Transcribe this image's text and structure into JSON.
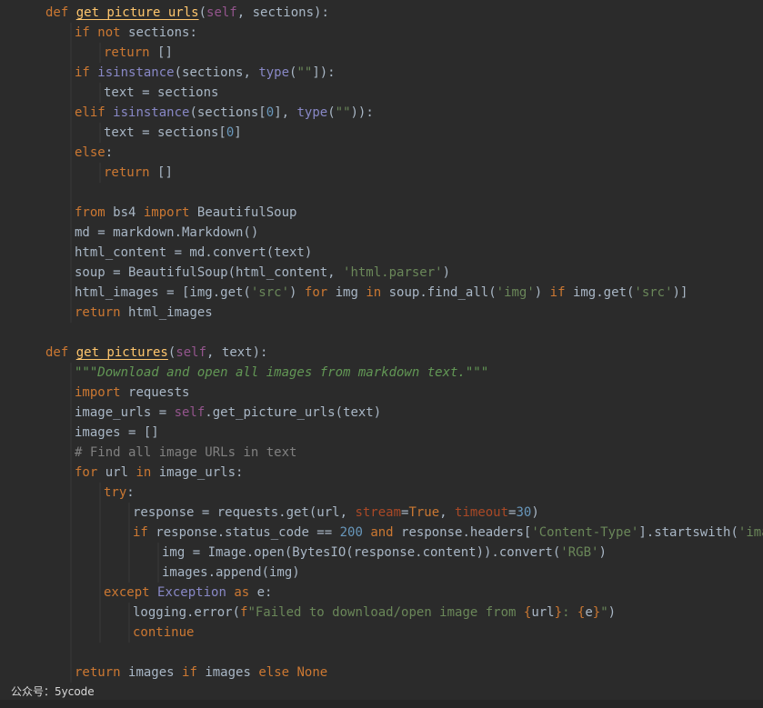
{
  "editor": {
    "language": "python",
    "colors": {
      "background": "#2b2b2b",
      "text": "#a9b7c6",
      "keyword": "#cc7832",
      "function": "#ffc66d",
      "self": "#94558d",
      "builtin": "#8888c6",
      "string": "#6a8759",
      "number": "#6897bb",
      "docstring": "#629755",
      "comment": "#808080",
      "param": "#aa4926"
    },
    "lines": [
      {
        "indent": 1,
        "tokens": [
          [
            "kw",
            "def "
          ],
          [
            "fn",
            "get_picture_urls"
          ],
          [
            "p",
            "("
          ],
          [
            "self",
            "self"
          ],
          [
            "p",
            ", sections):"
          ]
        ]
      },
      {
        "indent": 2,
        "tokens": [
          [
            "kw",
            "if not "
          ],
          [
            "p",
            "sections:"
          ]
        ]
      },
      {
        "indent": 3,
        "tokens": [
          [
            "kw",
            "return "
          ],
          [
            "p",
            "[]"
          ]
        ]
      },
      {
        "indent": 2,
        "tokens": [
          [
            "kw",
            "if "
          ],
          [
            "builtin",
            "isinstance"
          ],
          [
            "p",
            "(sections, "
          ],
          [
            "builtin",
            "type"
          ],
          [
            "p",
            "("
          ],
          [
            "str",
            "\"\""
          ],
          [
            "p",
            "]):"
          ]
        ]
      },
      {
        "indent": 3,
        "tokens": [
          [
            "p",
            "text = sections"
          ]
        ]
      },
      {
        "indent": 2,
        "tokens": [
          [
            "kw",
            "elif "
          ],
          [
            "builtin",
            "isinstance"
          ],
          [
            "p",
            "(sections["
          ],
          [
            "num",
            "0"
          ],
          [
            "p",
            "], "
          ],
          [
            "builtin",
            "type"
          ],
          [
            "p",
            "("
          ],
          [
            "str",
            "\"\""
          ],
          [
            "p",
            ")):"
          ]
        ]
      },
      {
        "indent": 3,
        "tokens": [
          [
            "p",
            "text = sections["
          ],
          [
            "num",
            "0"
          ],
          [
            "p",
            "]"
          ]
        ]
      },
      {
        "indent": 2,
        "tokens": [
          [
            "kw",
            "else"
          ],
          [
            "p",
            ":"
          ]
        ]
      },
      {
        "indent": 3,
        "tokens": [
          [
            "kw",
            "return "
          ],
          [
            "p",
            "[]"
          ]
        ]
      },
      {
        "indent": 0,
        "tokens": []
      },
      {
        "indent": 2,
        "tokens": [
          [
            "kw",
            "from "
          ],
          [
            "p",
            "bs4 "
          ],
          [
            "kw",
            "import "
          ],
          [
            "p",
            "BeautifulSoup"
          ]
        ]
      },
      {
        "indent": 2,
        "tokens": [
          [
            "p",
            "md = markdown.Markdown()"
          ]
        ]
      },
      {
        "indent": 2,
        "tokens": [
          [
            "p",
            "html_content = md.convert(text)"
          ]
        ]
      },
      {
        "indent": 2,
        "tokens": [
          [
            "p",
            "soup = BeautifulSoup(html_content, "
          ],
          [
            "str",
            "'html.parser'"
          ],
          [
            "p",
            ")"
          ]
        ]
      },
      {
        "indent": 2,
        "tokens": [
          [
            "p",
            "html_images = [img.get("
          ],
          [
            "str",
            "'src'"
          ],
          [
            "p",
            ") "
          ],
          [
            "kw",
            "for "
          ],
          [
            "p",
            "img "
          ],
          [
            "kw",
            "in "
          ],
          [
            "p",
            "soup.find_all("
          ],
          [
            "str",
            "'img'"
          ],
          [
            "p",
            ") "
          ],
          [
            "kw",
            "if "
          ],
          [
            "p",
            "img.get("
          ],
          [
            "str",
            "'src'"
          ],
          [
            "p",
            ")]"
          ]
        ]
      },
      {
        "indent": 2,
        "tokens": [
          [
            "kw",
            "return "
          ],
          [
            "p",
            "html_images"
          ]
        ]
      },
      {
        "indent": 0,
        "tokens": []
      },
      {
        "indent": 1,
        "tokens": [
          [
            "kw",
            "def "
          ],
          [
            "fn",
            "get_pictures"
          ],
          [
            "p",
            "("
          ],
          [
            "self",
            "self"
          ],
          [
            "p",
            ", text):"
          ]
        ]
      },
      {
        "indent": 2,
        "tokens": [
          [
            "doc",
            "\"\"\"Download and open all images from markdown text.\"\"\""
          ]
        ]
      },
      {
        "indent": 2,
        "tokens": [
          [
            "kw",
            "import "
          ],
          [
            "p",
            "requests"
          ]
        ]
      },
      {
        "indent": 2,
        "tokens": [
          [
            "p",
            "image_urls = "
          ],
          [
            "self",
            "self"
          ],
          [
            "p",
            ".get_picture_urls(text)"
          ]
        ]
      },
      {
        "indent": 2,
        "tokens": [
          [
            "p",
            "images = []"
          ]
        ]
      },
      {
        "indent": 2,
        "tokens": [
          [
            "cmt",
            "# Find all image URLs in text"
          ]
        ]
      },
      {
        "indent": 2,
        "tokens": [
          [
            "kw",
            "for "
          ],
          [
            "p",
            "url "
          ],
          [
            "kw",
            "in "
          ],
          [
            "p",
            "image_urls:"
          ]
        ]
      },
      {
        "indent": 3,
        "tokens": [
          [
            "kw",
            "try"
          ],
          [
            "p",
            ":"
          ]
        ]
      },
      {
        "indent": 4,
        "tokens": [
          [
            "p",
            "response = requests.get(url, "
          ],
          [
            "param",
            "stream"
          ],
          [
            "p",
            "="
          ],
          [
            "kw",
            "True"
          ],
          [
            "p",
            ", "
          ],
          [
            "param",
            "timeout"
          ],
          [
            "p",
            "="
          ],
          [
            "num",
            "30"
          ],
          [
            "p",
            ")"
          ]
        ]
      },
      {
        "indent": 4,
        "tokens": [
          [
            "kw",
            "if "
          ],
          [
            "p",
            "response.status_code == "
          ],
          [
            "num",
            "200 "
          ],
          [
            "kw",
            "and "
          ],
          [
            "p",
            "response.headers["
          ],
          [
            "str",
            "'Content-Type'"
          ],
          [
            "p",
            "].startswith("
          ],
          [
            "str",
            "'image/'"
          ],
          [
            "p",
            ")"
          ]
        ]
      },
      {
        "indent": 5,
        "tokens": [
          [
            "p",
            "img = Image.open(BytesIO(response.content)).convert("
          ],
          [
            "str",
            "'RGB'"
          ],
          [
            "p",
            ")"
          ]
        ]
      },
      {
        "indent": 5,
        "tokens": [
          [
            "p",
            "images.append(img)"
          ]
        ]
      },
      {
        "indent": 3,
        "tokens": [
          [
            "kw",
            "except "
          ],
          [
            "builtin",
            "Exception "
          ],
          [
            "kw",
            "as "
          ],
          [
            "p",
            "e:"
          ]
        ]
      },
      {
        "indent": 4,
        "tokens": [
          [
            "p",
            "logging.error("
          ],
          [
            "kw",
            "f"
          ],
          [
            "str",
            "\"Failed to download/open image from "
          ],
          [
            "kw",
            "{"
          ],
          [
            "p",
            "url"
          ],
          [
            "kw",
            "}"
          ],
          [
            "str",
            ": "
          ],
          [
            "kw",
            "{"
          ],
          [
            "p",
            "e"
          ],
          [
            "kw",
            "}"
          ],
          [
            "str",
            "\""
          ],
          [
            "p",
            ")"
          ]
        ]
      },
      {
        "indent": 4,
        "tokens": [
          [
            "kw",
            "continue"
          ]
        ]
      },
      {
        "indent": 0,
        "tokens": []
      },
      {
        "indent": 2,
        "tokens": [
          [
            "kw",
            "return "
          ],
          [
            "p",
            "images "
          ],
          [
            "kw",
            "if "
          ],
          [
            "p",
            "images "
          ],
          [
            "kw",
            "else "
          ],
          [
            "kw",
            "None"
          ]
        ]
      }
    ]
  },
  "watermark": "公众号：5ycode"
}
